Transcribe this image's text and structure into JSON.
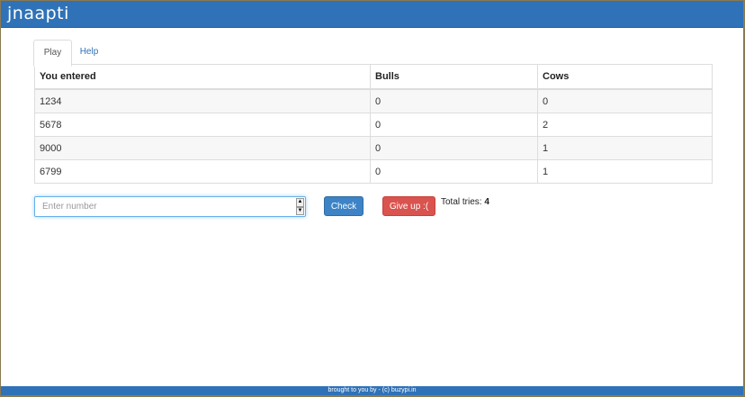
{
  "header": {
    "brand": "jnaapti"
  },
  "tabs": [
    {
      "label": "Play",
      "active": true
    },
    {
      "label": "Help",
      "active": false
    }
  ],
  "table": {
    "headers": [
      "You entered",
      "Bulls",
      "Cows"
    ],
    "rows": [
      [
        "1234",
        "0",
        "0"
      ],
      [
        "5678",
        "0",
        "2"
      ],
      [
        "9000",
        "0",
        "1"
      ],
      [
        "6799",
        "0",
        "1"
      ]
    ]
  },
  "form": {
    "input_placeholder": "Enter number",
    "check_label": "Check",
    "giveup_label": "Give up :(",
    "tries_label": "Total tries: ",
    "tries_count": "4"
  },
  "footer": {
    "text": "brought to you by - (c) buzypi.in"
  },
  "colors": {
    "primary": "#2f72b7",
    "danger": "#d9534f"
  }
}
